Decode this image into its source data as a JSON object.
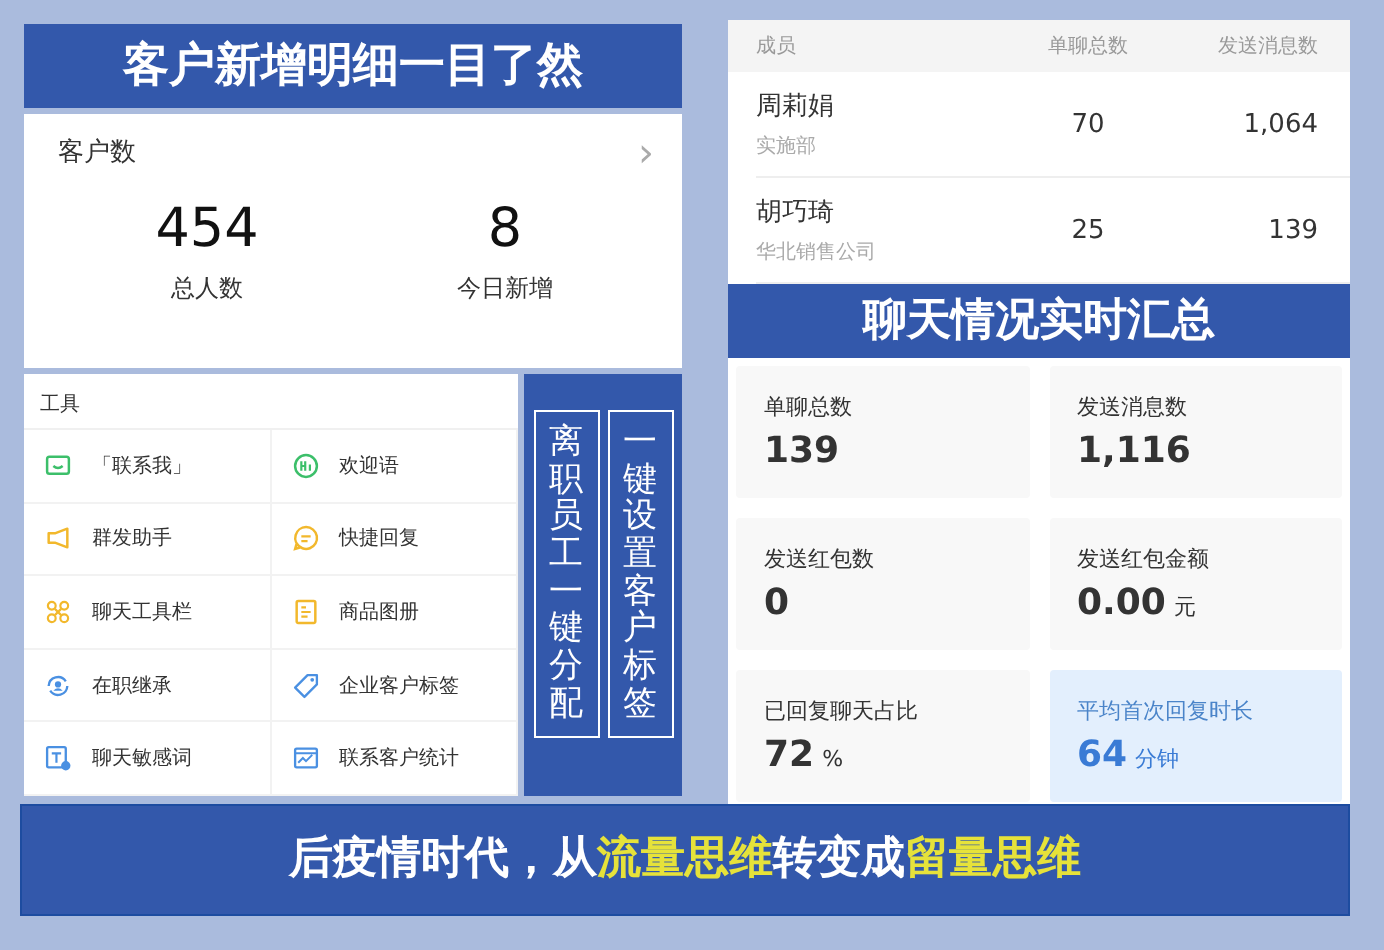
{
  "customer_banner": {
    "title": "客户新增明细一目了然"
  },
  "customer_card": {
    "title": "客户数",
    "chevron": "›",
    "metrics": [
      {
        "value": "454",
        "label": "总人数"
      },
      {
        "value": "8",
        "label": "今日新增"
      }
    ]
  },
  "tools": {
    "title": "工具",
    "items": [
      {
        "label": "「联系我」"
      },
      {
        "label": "欢迎语"
      },
      {
        "label": "群发助手"
      },
      {
        "label": "快捷回复"
      },
      {
        "label": "聊天工具栏"
      },
      {
        "label": "商品图册"
      },
      {
        "label": "在职继承"
      },
      {
        "label": "企业客户标签"
      },
      {
        "label": "聊天敏感词"
      },
      {
        "label": "联系客户统计"
      }
    ]
  },
  "vertical_banner": {
    "columns": [
      "离职员工一键分配",
      "一键设置客户标签"
    ]
  },
  "member_table": {
    "columns": [
      "成员",
      "单聊总数",
      "发送消息数"
    ],
    "rows": [
      {
        "name": "周莉娟",
        "department": "实施部",
        "chats": "70",
        "messages": "1,064"
      },
      {
        "name": "胡巧琦",
        "department": "华北销售公司",
        "chats": "25",
        "messages": "139"
      }
    ]
  },
  "chat_banner": {
    "title": "聊天情况实时汇总"
  },
  "stats": [
    {
      "label": "单聊总数",
      "value": "139",
      "highlighted": false
    },
    {
      "label": "发送消息数",
      "value": "1,116",
      "highlighted": false
    },
    {
      "label": "发送红包数",
      "value": "0",
      "highlighted": false
    },
    {
      "label": "发送红包金额",
      "value": "0.00",
      "unit": "元",
      "highlighted": false
    },
    {
      "label": "已回复聊天占比",
      "value": "72",
      "unit": "%",
      "highlighted": false
    },
    {
      "label": "平均首次回复时长",
      "value": "64",
      "unit": "分钟",
      "highlighted": true
    }
  ],
  "bottom_banner": {
    "segments": [
      {
        "text": "后疫情时代，从",
        "highlight": false
      },
      {
        "text": "流量思维",
        "highlight": true
      },
      {
        "text": "转变成",
        "highlight": false
      },
      {
        "text": "留量思维",
        "highlight": true
      }
    ]
  }
}
